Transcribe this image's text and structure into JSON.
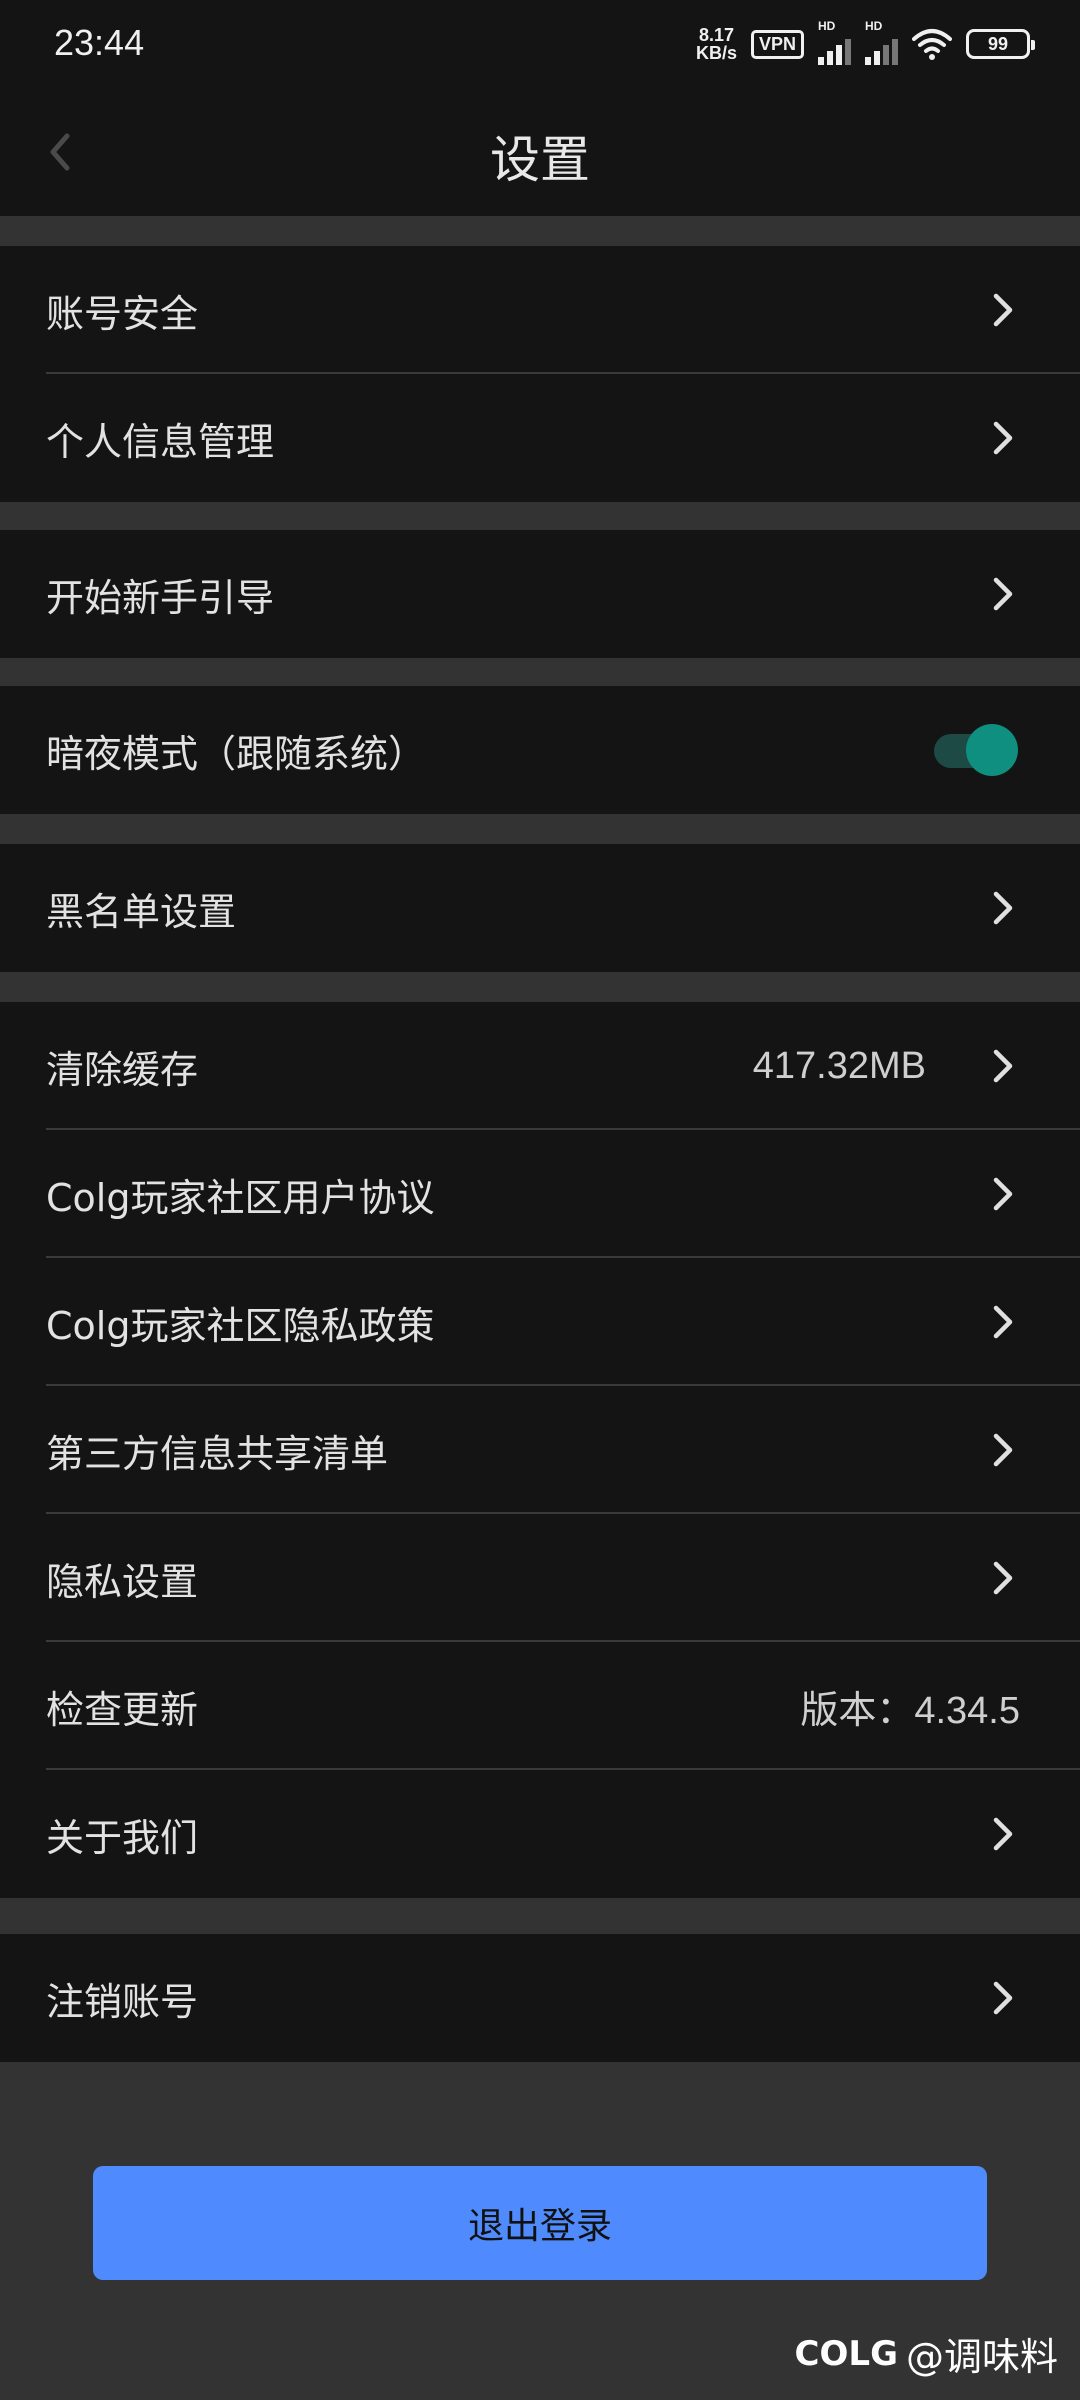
{
  "status_bar": {
    "time": "23:44",
    "net_speed_value": "8.17",
    "net_speed_unit": "KB/s",
    "vpn": "VPN",
    "hd1": "HD",
    "hd2": "HD",
    "battery": "99"
  },
  "header": {
    "title": "设置"
  },
  "groups": {
    "account": {
      "security": "账号安全",
      "personal_info": "个人信息管理"
    },
    "guide": {
      "start_guide": "开始新手引导"
    },
    "dark": {
      "dark_mode": "暗夜模式（跟随系统）",
      "dark_mode_on": true
    },
    "blacklist": {
      "label": "黑名单设置"
    },
    "misc": {
      "clear_cache": "清除缓存",
      "cache_size": "417.32MB",
      "user_agreement": "Colg玩家社区用户协议",
      "privacy_policy": "Colg玩家社区隐私政策",
      "third_party": "第三方信息共享清单",
      "privacy_settings": "隐私设置",
      "check_update": "检查更新",
      "version": "版本：4.34.5",
      "about": "关于我们"
    },
    "cancel": {
      "label": "注销账号"
    }
  },
  "logout_label": "退出登录",
  "watermark": {
    "logo": "COLG",
    "handle": "@调味料"
  },
  "colors": {
    "accent": "#4f8bff",
    "toggle": "#0f8f80",
    "background": "#141414"
  }
}
